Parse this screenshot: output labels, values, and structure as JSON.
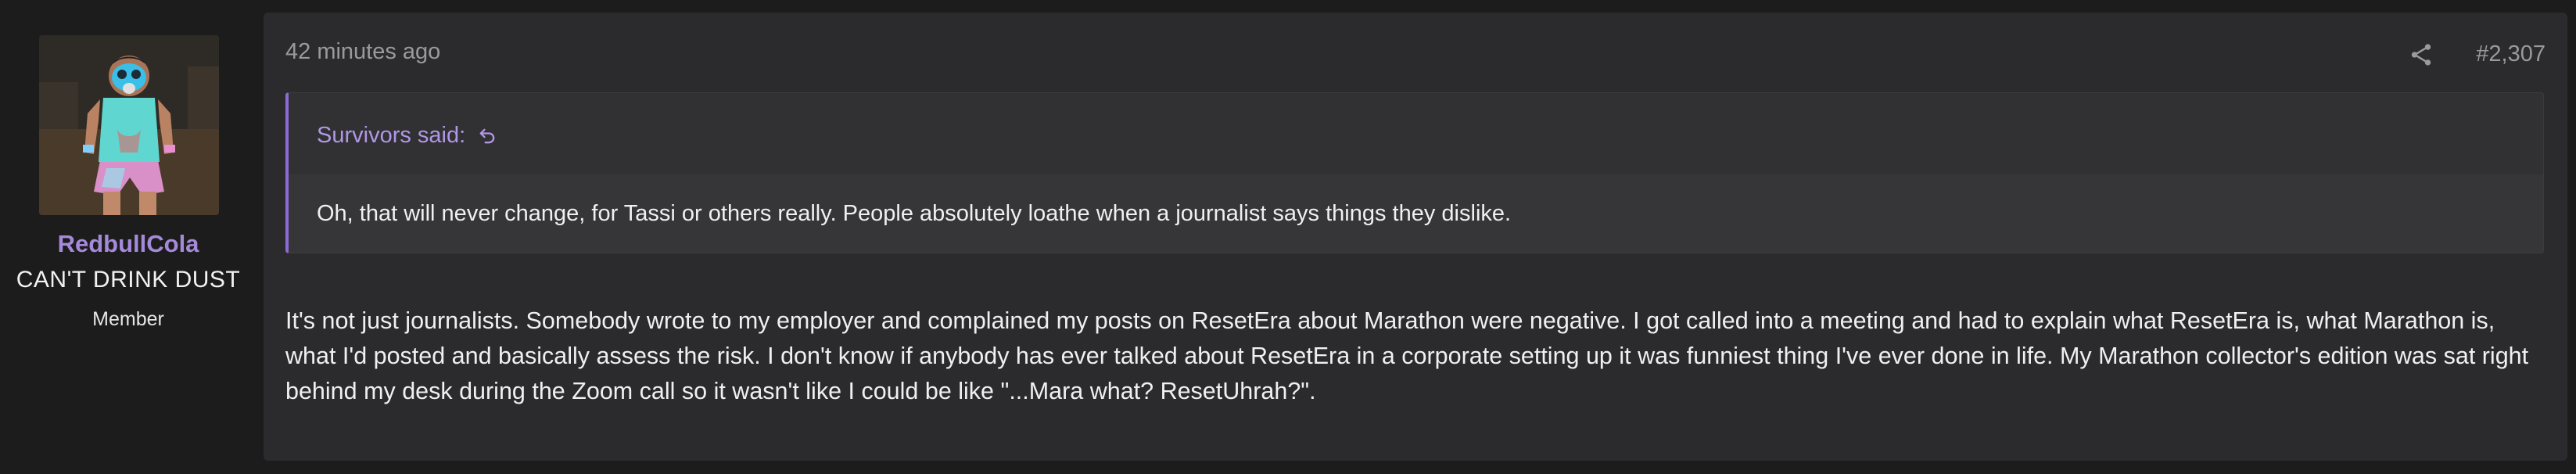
{
  "user": {
    "name": "RedbullCola",
    "title": "CAN'T DRINK DUST",
    "role": "Member"
  },
  "post": {
    "time": "42 minutes ago",
    "number": "#2,307",
    "quote": {
      "author_said": "Survivors said:",
      "text": "Oh, that will never change, for Tassi or others really. People absolutely loathe when a journalist says things they dislike."
    },
    "body": "It's not just journalists. Somebody wrote to my employer and complained my posts on ResetEra about Marathon were negative. I got called into a meeting and had to explain what ResetEra is, what Marathon is, what I'd posted and basically assess the risk. I don't know if anybody has ever talked about ResetEra in a corporate setting up it was funniest thing I've ever done in life. My Marathon collector's edition was sat right behind my desk during the Zoom call so it wasn't like I could be like \"...Mara what? ResetUhrah?\"."
  },
  "icons": {
    "share": "share-icon",
    "quote_jump": "jump-to-quote-icon"
  },
  "colors": {
    "accent": "#a58ad9",
    "quote_border": "#8c6ad6",
    "background": "#1c1c1d",
    "card": "#2b2b2d"
  }
}
